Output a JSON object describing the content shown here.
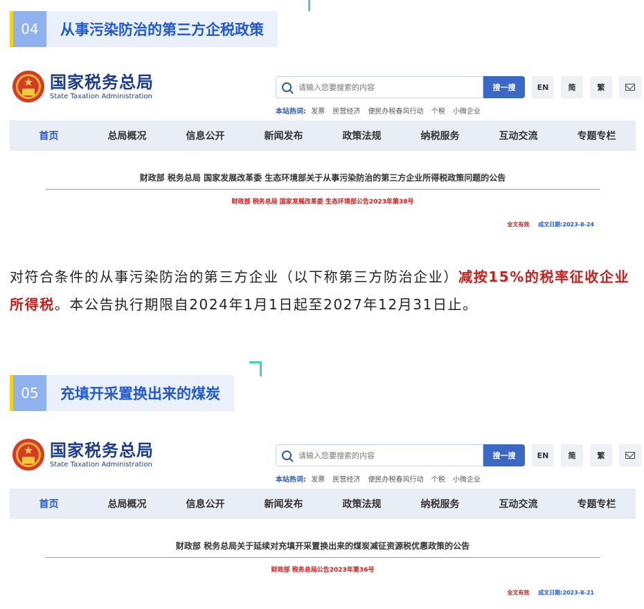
{
  "section4": {
    "number": "04",
    "title": "从事污染防治的第三方企税政策"
  },
  "section5": {
    "number": "05",
    "title": "充填开采置换出来的煤炭"
  },
  "portal": {
    "logo_cn": "国家税务总局",
    "logo_en": "State Taxation Administration",
    "search_placeholder": "请输入您要搜索的内容",
    "search_button": "搜一搜",
    "lang_en": "EN",
    "lang_simplified": "简",
    "lang_traditional": "繁",
    "hot_label": "本站热词:",
    "hot_words": [
      "发票",
      "民营经济",
      "便民办税春风行动",
      "个税",
      "小微企业"
    ],
    "nav": [
      "首页",
      "总局概况",
      "信息公开",
      "新闻发布",
      "政策法规",
      "纳税服务",
      "互动交流",
      "专题专栏"
    ]
  },
  "announcement1": {
    "title": "财政部 税务总局 国家发展改革委 生态环境部关于从事污染防治的第三方企业所得税政策问题的公告",
    "doc_no": "财政部 税务总局 国家发展改革委 生态环境部公告2023年第38号",
    "validity": "全文有效",
    "date": "成文日期:2023-8-24"
  },
  "announcement2": {
    "title": "财政部 税务总局关于延续对充填开采置换出来的煤炭减征资源税优惠政策的公告",
    "doc_no": "财政部 税务总局公告2023年第36号",
    "validity": "全文有效",
    "date": "成文日期:2023-8-21"
  },
  "paragraph": {
    "part1": "对符合条件的从事污染防治的第三方企业（以下称第三方防治企业）",
    "highlight": "减按15%的税率征收企业所得税",
    "part2": "。本公告执行期限自2024年1月1日起至2027年12月31日止。"
  }
}
